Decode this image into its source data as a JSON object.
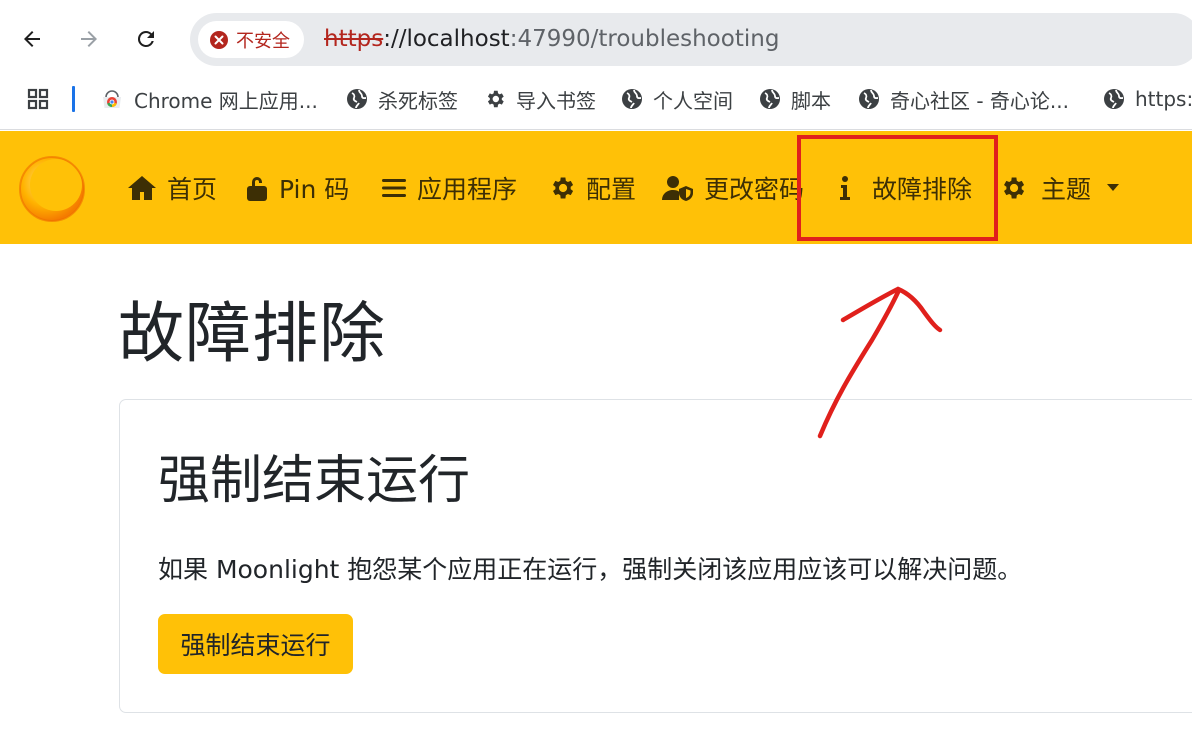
{
  "browser": {
    "security_label": "不安全",
    "url_scheme": "https",
    "url_host": "://localhost",
    "url_rest": ":47990/troubleshooting"
  },
  "bookmarks": [
    {
      "label": "Chrome 网上应用...",
      "icon": "chrome-web-store-icon"
    },
    {
      "label": "杀死标签",
      "icon": "globe-icon"
    },
    {
      "label": "导入书签",
      "icon": "gear-icon"
    },
    {
      "label": "个人空间",
      "icon": "globe-icon"
    },
    {
      "label": "脚本",
      "icon": "globe-icon"
    },
    {
      "label": "奇心社区 - 奇心论...",
      "icon": "globe-icon"
    },
    {
      "label": "https:/",
      "icon": "globe-icon"
    }
  ],
  "navbar": {
    "items": [
      {
        "label": "首页",
        "icon": "home-icon"
      },
      {
        "label": "Pin 码",
        "icon": "unlock-icon"
      },
      {
        "label": "应用程序",
        "icon": "list-icon"
      },
      {
        "label": "配置",
        "icon": "gear-icon"
      },
      {
        "label": "更改密码",
        "icon": "user-shield-icon"
      },
      {
        "label": "故障排除",
        "icon": "info-icon"
      },
      {
        "label": "主题",
        "icon": "gear-icon"
      }
    ]
  },
  "page": {
    "title": "故障排除"
  },
  "card": {
    "title": "强制结束运行",
    "description": "如果 Moonlight 抱怨某个应用正在运行，强制关闭该应用应该可以解决问题。",
    "button_label": "强制结束运行"
  },
  "colors": {
    "navbar_bg": "#ffc107",
    "highlight_box": "#e0201c",
    "insecure_red": "#b3261e"
  }
}
